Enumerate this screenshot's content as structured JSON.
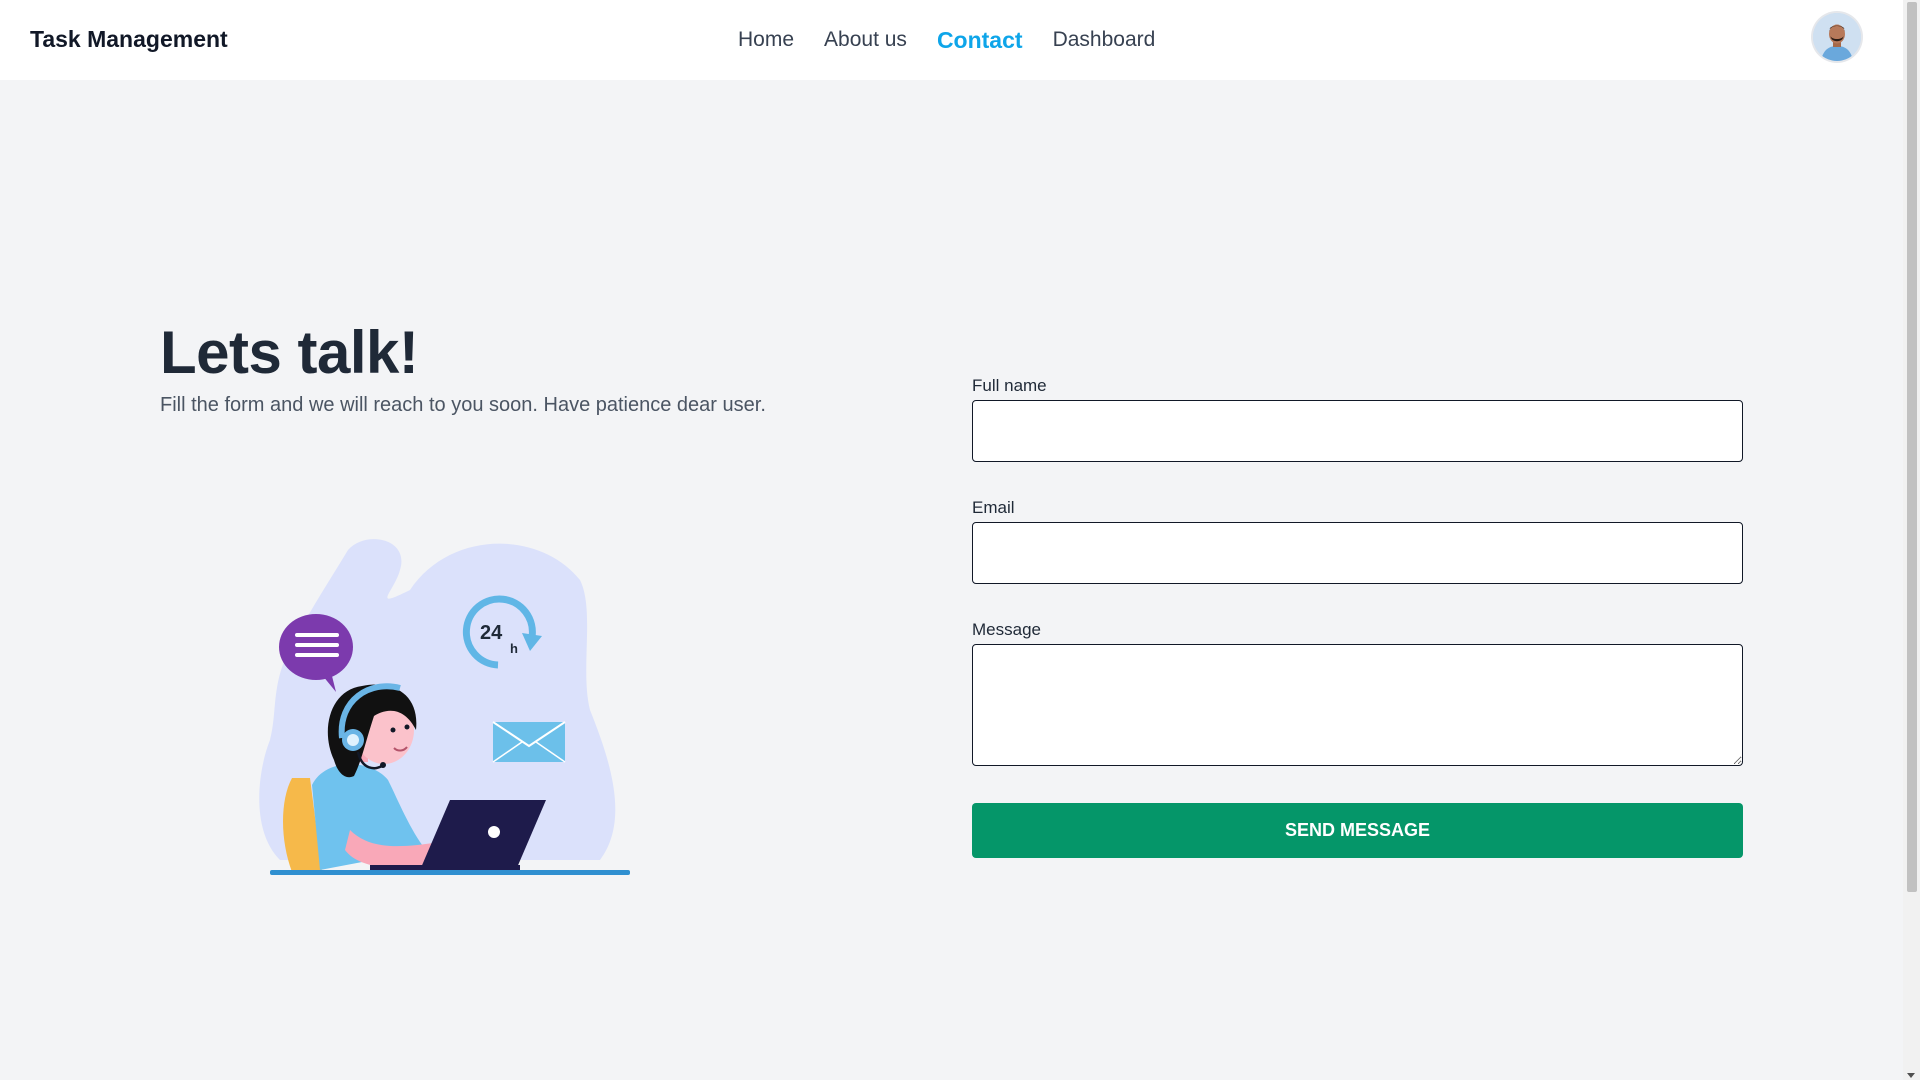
{
  "navbar": {
    "brand": "Task Management",
    "links": [
      {
        "label": "Home",
        "active": false
      },
      {
        "label": "About us",
        "active": false
      },
      {
        "label": "Contact",
        "active": true
      },
      {
        "label": "Dashboard",
        "active": false
      }
    ]
  },
  "hero": {
    "title": "Lets talk!",
    "subtitle": "Fill the form and we will reach to you soon. Have patience dear user.",
    "illustration_badge": "24",
    "illustration_badge_unit": "h"
  },
  "form": {
    "full_name": {
      "label": "Full name",
      "value": ""
    },
    "email": {
      "label": "Email",
      "value": ""
    },
    "message": {
      "label": "Message",
      "value": ""
    },
    "submit_label": "SEND MESSAGE"
  },
  "colors": {
    "accent": "#0ea5e9",
    "button": "#059669",
    "background": "#f3f4f6"
  },
  "icons": [
    "user-avatar",
    "chat-bubble-icon",
    "24h-clock-icon",
    "envelope-icon",
    "laptop-icon",
    "headset-icon"
  ]
}
